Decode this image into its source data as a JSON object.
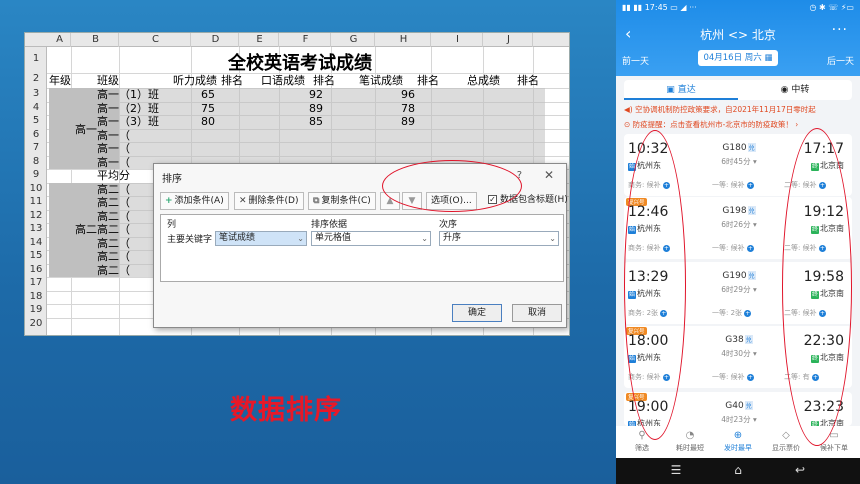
{
  "excel": {
    "columns": [
      "A",
      "B",
      "C",
      "D",
      "E",
      "F",
      "G",
      "H",
      "I",
      "J"
    ],
    "rows": [
      "1",
      "2",
      "3",
      "4",
      "5",
      "6",
      "7",
      "8",
      "9",
      "10",
      "11",
      "12",
      "13",
      "14",
      "15",
      "16",
      "17",
      "18",
      "19",
      "20"
    ],
    "title": "全校英语考试成绩",
    "headers": [
      "年级",
      "班级",
      "听力成绩",
      "排名",
      "口语成绩",
      "排名",
      "笔试成绩",
      "排名",
      "总成绩",
      "排名"
    ],
    "grade1": "高一",
    "grade2": "高二",
    "class_rows": [
      {
        "cls": "高一（1）班",
        "listen": "65",
        "oral": "92",
        "written": "96"
      },
      {
        "cls": "高一（2）班",
        "listen": "75",
        "oral": "89",
        "written": "78"
      },
      {
        "cls": "高一（3）班",
        "listen": "80",
        "oral": "85",
        "written": "89"
      },
      {
        "cls": "高一（",
        "listen": "",
        "oral": "",
        "written": ""
      },
      {
        "cls": "高一（",
        "listen": "",
        "oral": "",
        "written": ""
      },
      {
        "cls": "高一（",
        "listen": "",
        "oral": "",
        "written": ""
      },
      {
        "cls": "平均分",
        "listen": "",
        "oral": "",
        "written": ""
      },
      {
        "cls": "高二（",
        "listen": "",
        "oral": "",
        "written": ""
      },
      {
        "cls": "高二（",
        "listen": "",
        "oral": "",
        "written": ""
      },
      {
        "cls": "高二（",
        "listen": "",
        "oral": "",
        "written": ""
      },
      {
        "cls": "高二（",
        "listen": "",
        "oral": "",
        "written": ""
      },
      {
        "cls": "高二（",
        "listen": "",
        "oral": "",
        "written": ""
      },
      {
        "cls": "高二（",
        "listen": "",
        "oral": "",
        "written": ""
      },
      {
        "cls": "高二（",
        "listen": "",
        "oral": "",
        "written": ""
      }
    ]
  },
  "dialog": {
    "title": "排序",
    "help": "?",
    "close": "✕",
    "add_condition": "添加条件(A)",
    "delete_condition": "删除条件(D)",
    "copy_condition": "复制条件(C)",
    "up": "▲",
    "down": "▼",
    "options": "选项(O)...",
    "has_headers": "数据包含标题(H)",
    "col_header": "列",
    "basis_header": "排序依据",
    "order_header": "次序",
    "key_label": "主要关键字",
    "key_value": "笔试成绩",
    "basis_value": "单元格值",
    "order_value": "升序",
    "ok": "确定",
    "cancel": "取消"
  },
  "caption": "数据排序",
  "phone": {
    "status_left": "▮▮ ▮▮ 17:45 ▭ ◢ ···",
    "status_right": "◷ ✱ ☏ ⚡▭",
    "route": "杭州 <> 北京",
    "more": "···",
    "prev_day": "前一天",
    "next_day": "后一天",
    "date": "04月16日 周六",
    "tab_direct": "直达",
    "tab_transfer": "中转",
    "notice1": "◀) 空协调机制防控政策要求，自2021年11月17日零时起",
    "notice2": "⊙ 防疫提醒：点击查看杭州市-北京市的防疫政策！ ›",
    "trains": [
      {
        "dep": "10:32",
        "arr": "17:17",
        "from": "杭州东",
        "to": "北京南",
        "no": "G180",
        "fx": "兑",
        "dur": "6时45分 ▾",
        "s1": "商务: 候补",
        "s2": "一等: 候补",
        "s3": "二等: 候补",
        "tag": ""
      },
      {
        "dep": "12:46",
        "arr": "19:12",
        "from": "杭州东",
        "to": "北京南",
        "no": "G198",
        "fx": "兑",
        "dur": "6时26分 ▾",
        "s1": "商务: 候补",
        "s2": "一等: 候补",
        "s3": "二等: 候补",
        "tag": "复兴号"
      },
      {
        "dep": "13:29",
        "arr": "19:58",
        "from": "杭州东",
        "to": "北京南",
        "no": "G190",
        "fx": "兑",
        "dur": "6时29分 ▾",
        "s1": "商务: 2张",
        "s2": "一等: 2张",
        "s3": "二等: 候补",
        "tag": ""
      },
      {
        "dep": "18:00",
        "arr": "22:30",
        "from": "杭州东",
        "to": "北京南",
        "no": "G38",
        "fx": "兑",
        "dur": "4时30分 ▾",
        "s1": "商务: 候补",
        "s2": "一等: 候补",
        "s3": "二等: 有",
        "tag": "复兴号"
      },
      {
        "dep": "19:00",
        "arr": "23:23",
        "from": "杭州东",
        "to": "北京南",
        "no": "G40",
        "fx": "兑",
        "dur": "4时23分 ▾",
        "s1": "",
        "s2": "",
        "s3": "",
        "tag": "复兴号"
      }
    ],
    "bottom": [
      {
        "icon": "⚲",
        "label": "筛选"
      },
      {
        "icon": "◔",
        "label": "耗时最短"
      },
      {
        "icon": "⊕",
        "label": "发时最早"
      },
      {
        "icon": "◇",
        "label": "显示票价"
      },
      {
        "icon": "▭",
        "label": "候补下单"
      }
    ],
    "nav": [
      "☰",
      "⌂",
      "↩"
    ]
  }
}
